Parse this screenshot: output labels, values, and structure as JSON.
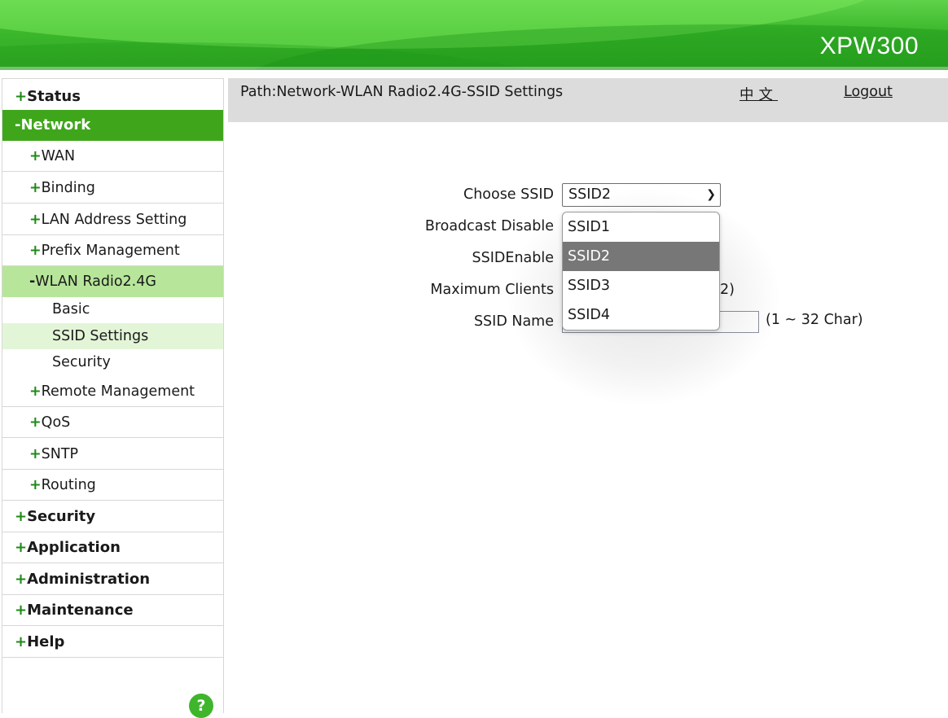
{
  "header": {
    "model_name": "XPW300"
  },
  "sidebar": {
    "items": [
      {
        "sign": "+",
        "label": "Status",
        "level": 1
      },
      {
        "sign": "-",
        "label": "Network",
        "level": 1,
        "active": true
      },
      {
        "sign": "+",
        "label": "WAN",
        "level": 2
      },
      {
        "sign": "+",
        "label": "Binding",
        "level": 2
      },
      {
        "sign": "+",
        "label": "LAN Address Setting",
        "level": 2
      },
      {
        "sign": "+",
        "label": "Prefix Management",
        "level": 2
      },
      {
        "sign": "-",
        "label": "WLAN Radio2.4G",
        "level": 2,
        "active": true
      },
      {
        "label": "Basic",
        "level": 3
      },
      {
        "label": "SSID Settings",
        "level": 3,
        "active": true
      },
      {
        "label": "Security",
        "level": 3
      },
      {
        "sign": "+",
        "label": "Remote Management",
        "level": 2
      },
      {
        "sign": "+",
        "label": "QoS",
        "level": 2
      },
      {
        "sign": "+",
        "label": "SNTP",
        "level": 2
      },
      {
        "sign": "+",
        "label": "Routing",
        "level": 2
      },
      {
        "sign": "+",
        "label": "Security",
        "level": 1
      },
      {
        "sign": "+",
        "label": "Application",
        "level": 1
      },
      {
        "sign": "+",
        "label": "Administration",
        "level": 1
      },
      {
        "sign": "+",
        "label": "Maintenance",
        "level": 1
      },
      {
        "sign": "+",
        "label": "Help",
        "level": 1
      }
    ],
    "help_icon": "?"
  },
  "pathbar": {
    "path": "Path:Network-WLAN Radio2.4G-SSID Settings",
    "language_link": "中文",
    "logout": "Logout"
  },
  "form": {
    "choose_ssid_label": "Choose SSID",
    "choose_ssid_value": "SSID2",
    "broadcast_disable_label": "Broadcast Disable",
    "ssid_enable_label": "SSIDEnable",
    "max_clients_label": "Maximum Clients",
    "max_clients_hint_visible": "2)",
    "ssid_name_label": "SSID Name",
    "ssid_name_hint": "(1 ~ 32 Char)"
  },
  "dropdown": {
    "options": [
      "SSID1",
      "SSID2",
      "SSID3",
      "SSID4"
    ],
    "selected": "SSID2"
  },
  "colors": {
    "banner_green": "#3cb82c",
    "active_menu_green": "#3fa61c",
    "active_submenu_green": "#b7e69a",
    "active_leaf_green": "#e3f5d7",
    "pathbar_gray": "#dcdcdc",
    "dropdown_selected_gray": "#777777"
  }
}
